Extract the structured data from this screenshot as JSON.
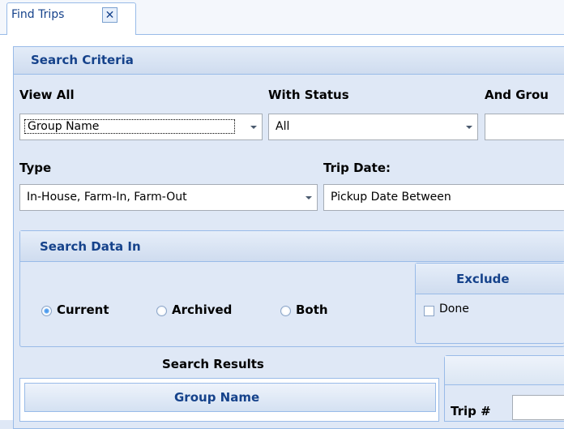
{
  "tabs": [
    {
      "label": "Find Trips",
      "close_icon": "close-icon"
    }
  ],
  "search_criteria": {
    "title": "Search Criteria",
    "view_all": {
      "label": "View All",
      "value": "Group Name"
    },
    "with_status": {
      "label": "With Status",
      "value": "All"
    },
    "and_group": {
      "label": "And Grou",
      "value": ""
    },
    "type": {
      "label": "Type",
      "value": "In-House, Farm-In, Farm-Out"
    },
    "trip_date": {
      "label": "Trip Date:",
      "value": "Pickup Date Between"
    }
  },
  "search_data_in": {
    "title": "Search Data In",
    "options": [
      {
        "label": "Current",
        "selected": true
      },
      {
        "label": "Archived",
        "selected": false
      },
      {
        "label": "Both",
        "selected": false
      }
    ]
  },
  "exclude": {
    "title": "Exclude",
    "done_label": "Done",
    "done_checked": false
  },
  "search_results": {
    "title": "Search Results",
    "columns": [
      "Group Name"
    ]
  },
  "trip_number": {
    "label": "Trip #",
    "value": ""
  },
  "colors": {
    "accent": "#15428b",
    "panel_bg": "#dfe8f6",
    "border": "#99bbe8",
    "radio_selected": "#3b8fe8"
  }
}
